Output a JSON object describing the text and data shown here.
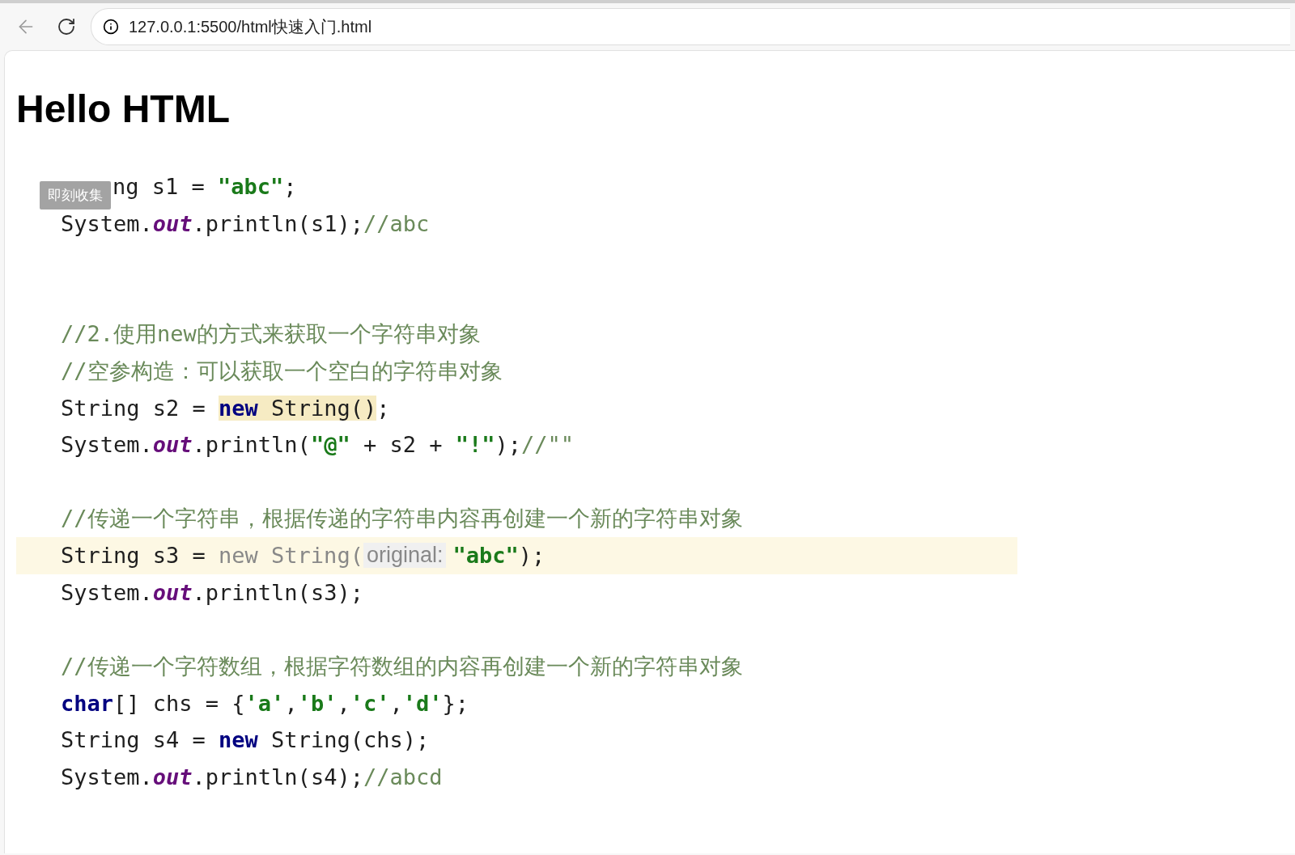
{
  "browser": {
    "url": "127.0.0.1:5500/html快速入门.html"
  },
  "page": {
    "heading": "Hello HTML",
    "overlay_badge": "即刻收集",
    "code_lines": [
      {
        "kind": "code",
        "current": false,
        "tokens": [
          {
            "text": "ng s1 = ",
            "kind": "plain"
          },
          {
            "text": "\"abc\"",
            "kind": "string"
          },
          {
            "text": ";",
            "kind": "plain"
          }
        ]
      },
      {
        "kind": "code",
        "current": false,
        "tokens": [
          {
            "text": "System.",
            "kind": "plain"
          },
          {
            "text": "out",
            "kind": "field"
          },
          {
            "text": ".println(s1);",
            "kind": "plain"
          },
          {
            "text": "//abc",
            "kind": "comment"
          }
        ]
      },
      {
        "kind": "blank"
      },
      {
        "kind": "blank"
      },
      {
        "kind": "code",
        "current": false,
        "tokens": [
          {
            "text": "//2.使用new的方式来获取一个字符串对象",
            "kind": "comment"
          }
        ]
      },
      {
        "kind": "code",
        "current": false,
        "tokens": [
          {
            "text": "//空参构造：可以获取一个空白的字符串对象",
            "kind": "comment"
          }
        ]
      },
      {
        "kind": "code",
        "current": false,
        "tokens": [
          {
            "text": "String s2 = ",
            "kind": "plain"
          },
          {
            "text": "new",
            "kind": "keyword",
            "highlighted": true
          },
          {
            "text": " String()",
            "kind": "plain",
            "highlighted": true
          },
          {
            "text": ";",
            "kind": "plain"
          }
        ]
      },
      {
        "kind": "code",
        "current": false,
        "tokens": [
          {
            "text": "System.",
            "kind": "plain"
          },
          {
            "text": "out",
            "kind": "field"
          },
          {
            "text": ".println(",
            "kind": "plain"
          },
          {
            "text": "\"@\"",
            "kind": "string"
          },
          {
            "text": " + s2 + ",
            "kind": "plain"
          },
          {
            "text": "\"!\"",
            "kind": "string"
          },
          {
            "text": ");",
            "kind": "plain"
          },
          {
            "text": "//\"\"",
            "kind": "comment"
          }
        ]
      },
      {
        "kind": "blank"
      },
      {
        "kind": "code",
        "current": false,
        "tokens": [
          {
            "text": "//传递一个字符串，根据传递的字符串内容再创建一个新的字符串对象",
            "kind": "comment"
          }
        ]
      },
      {
        "kind": "code",
        "current": true,
        "tokens": [
          {
            "text": "String s3 = ",
            "kind": "plain"
          },
          {
            "text": "new String(",
            "kind": "dim"
          },
          {
            "text": "original:",
            "kind": "hint"
          },
          {
            "text": "\"abc\"",
            "kind": "string"
          },
          {
            "text": ");",
            "kind": "plain"
          }
        ]
      },
      {
        "kind": "code",
        "current": false,
        "tokens": [
          {
            "text": "System.",
            "kind": "plain"
          },
          {
            "text": "out",
            "kind": "field"
          },
          {
            "text": ".println(s3);",
            "kind": "plain"
          }
        ]
      },
      {
        "kind": "blank"
      },
      {
        "kind": "code",
        "current": false,
        "tokens": [
          {
            "text": "//传递一个字符数组，根据字符数组的内容再创建一个新的字符串对象",
            "kind": "comment"
          }
        ]
      },
      {
        "kind": "code",
        "current": false,
        "tokens": [
          {
            "text": "char",
            "kind": "keyword"
          },
          {
            "text": "[] chs = {",
            "kind": "plain"
          },
          {
            "text": "'a'",
            "kind": "string"
          },
          {
            "text": ",",
            "kind": "plain"
          },
          {
            "text": "'b'",
            "kind": "string"
          },
          {
            "text": ",",
            "kind": "plain"
          },
          {
            "text": "'c'",
            "kind": "string"
          },
          {
            "text": ",",
            "kind": "plain"
          },
          {
            "text": "'d'",
            "kind": "string"
          },
          {
            "text": "};",
            "kind": "plain"
          }
        ]
      },
      {
        "kind": "code",
        "current": false,
        "tokens": [
          {
            "text": "String s4 = ",
            "kind": "plain"
          },
          {
            "text": "new",
            "kind": "keyword"
          },
          {
            "text": " String(chs);",
            "kind": "plain"
          }
        ]
      },
      {
        "kind": "code",
        "current": false,
        "tokens": [
          {
            "text": "System.",
            "kind": "plain"
          },
          {
            "text": "out",
            "kind": "field"
          },
          {
            "text": ".println(s4);",
            "kind": "plain"
          },
          {
            "text": "//abcd",
            "kind": "comment"
          }
        ]
      }
    ]
  }
}
